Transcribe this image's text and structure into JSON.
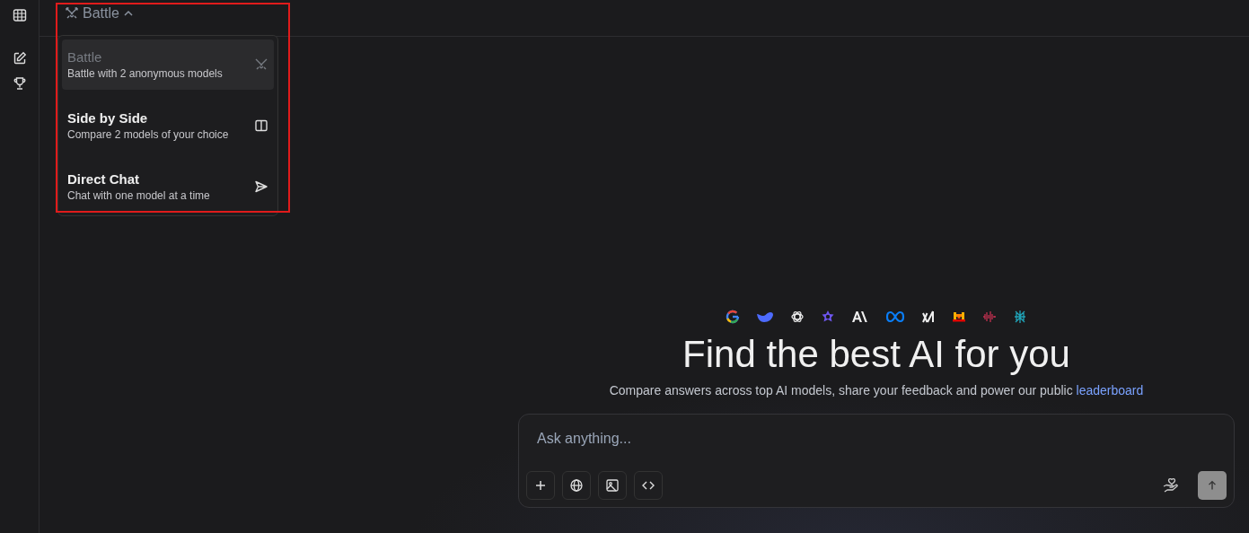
{
  "header": {
    "mode_label": "Battle",
    "menu_open": true
  },
  "mode_menu": [
    {
      "kind": "swords",
      "title": "Battle",
      "description": "Battle with 2 anonymous models",
      "selected": true
    },
    {
      "kind": "columns",
      "title": "Side by Side",
      "description": "Compare 2 models of your choice",
      "selected": false
    },
    {
      "kind": "send",
      "title": "Direct Chat",
      "description": "Chat with one model at a time",
      "selected": false
    }
  ],
  "hero": {
    "heading": "Find the best AI for you",
    "subtitle": "Compare answers across top AI models, share your feedback and power our public",
    "link": "leaderboard"
  },
  "composer": {
    "placeholder": "Ask anything...",
    "tools": [
      {
        "kind": "plus"
      },
      {
        "kind": "globe"
      },
      {
        "kind": "image"
      },
      {
        "kind": "code"
      }
    ]
  }
}
